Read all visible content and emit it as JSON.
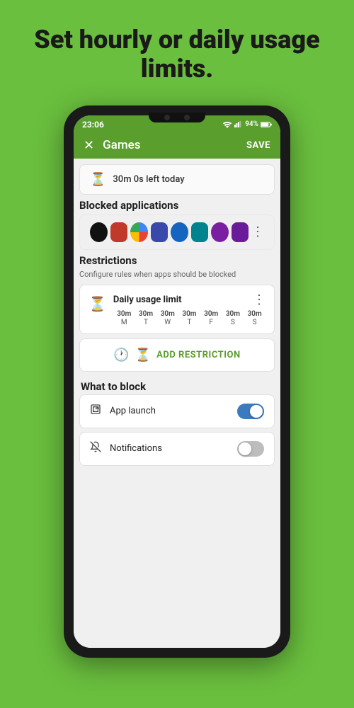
{
  "headline": "Set hourly or daily usage limits.",
  "statusBar": {
    "time": "23:06",
    "battery": "94%"
  },
  "appBar": {
    "closeLabel": "✕",
    "title": "Games",
    "saveLabel": "SAVE"
  },
  "timerSection": {
    "text": "30m 0s left today"
  },
  "blockedApps": {
    "heading": "Blocked applications",
    "moreLabel": "⋮",
    "apps": [
      {
        "color": "#111"
      },
      {
        "color": "#c0392b"
      },
      {
        "color": "#4285F4"
      },
      {
        "color": "#3949ab"
      },
      {
        "color": "#1565c0"
      },
      {
        "color": "#00838f"
      },
      {
        "color": "#7b1fa2"
      },
      {
        "color": "#6a1b9a"
      }
    ]
  },
  "restrictions": {
    "heading": "Restrictions",
    "subText": "Configure rules when apps should be blocked",
    "rule": {
      "title": "Daily usage limit",
      "moreLabel": "⋮",
      "days": [
        "M",
        "T",
        "W",
        "T",
        "F",
        "S",
        "S"
      ],
      "times": [
        "30m",
        "30m",
        "30m",
        "30m",
        "30m",
        "30m",
        "30m"
      ]
    },
    "addLabel": "ADD RESTRICTION"
  },
  "whatToBlock": {
    "heading": "What to block",
    "items": [
      {
        "icon": "↗",
        "label": "App launch",
        "toggleOn": true
      },
      {
        "icon": "🔕",
        "label": "Notifications",
        "toggleOn": false
      }
    ]
  }
}
